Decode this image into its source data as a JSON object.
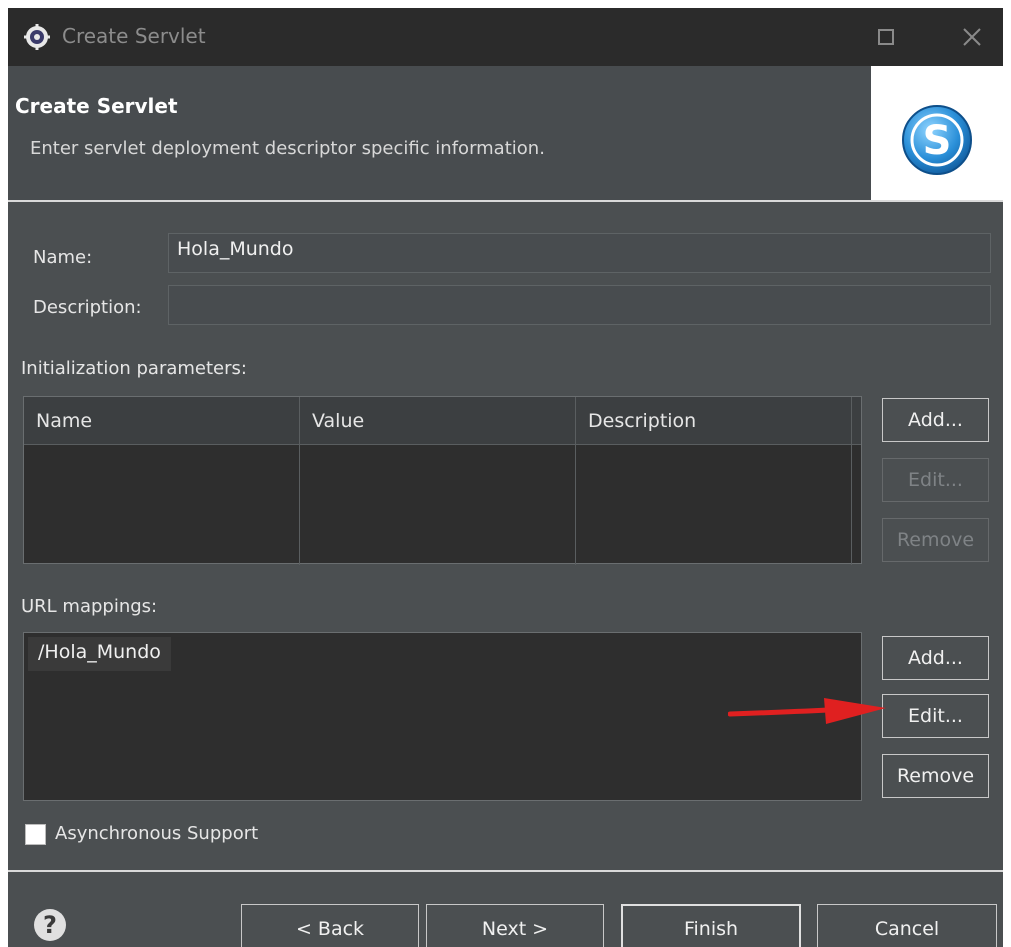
{
  "window": {
    "title": "Create Servlet"
  },
  "banner": {
    "heading": "Create Servlet",
    "subheading": "Enter servlet deployment descriptor specific information.",
    "logo_icon": "servlet-s-logo-icon",
    "logo_letter": "S"
  },
  "form": {
    "name_label": "Name:",
    "name_value": "Hola_Mundo",
    "description_label": "Description:",
    "description_value": ""
  },
  "init_params": {
    "label": "Initialization parameters:",
    "columns": [
      "Name",
      "Value",
      "Description"
    ],
    "rows": [],
    "buttons": {
      "add": "Add...",
      "edit": "Edit...",
      "remove": "Remove"
    }
  },
  "url_mappings": {
    "label": "URL mappings:",
    "rows": [
      "/Hola_Mundo"
    ],
    "buttons": {
      "add": "Add...",
      "edit": "Edit...",
      "remove": "Remove"
    }
  },
  "async": {
    "label": "Asynchronous Support",
    "checked": false
  },
  "footer": {
    "help_icon": "?",
    "back": "< Back",
    "next": "Next >",
    "finish": "Finish",
    "cancel": "Cancel"
  },
  "colors": {
    "background": "#4b4f51",
    "titlebar": "#2b2b2b",
    "table": "#2e2e2e",
    "annotation_arrow": "#e02020",
    "logo": "#2a8fd8"
  }
}
